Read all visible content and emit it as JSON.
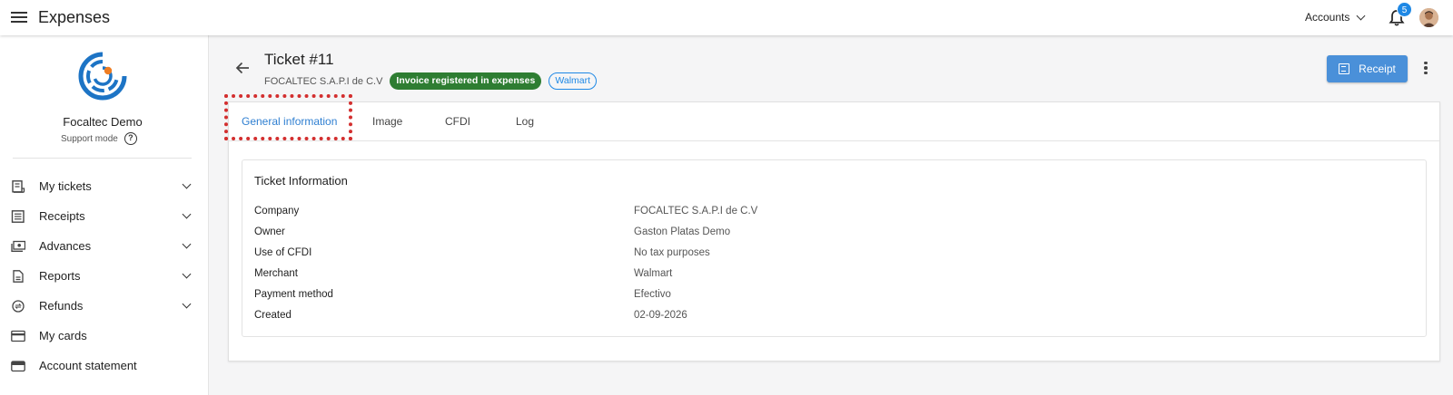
{
  "topbar": {
    "menu_icon": "menu-icon",
    "title": "Expenses",
    "accounts_label": "Accounts",
    "notification_count": "5"
  },
  "sidebar": {
    "org_name": "Focaltec Demo",
    "support_mode": "Support mode",
    "items": [
      {
        "label": "My tickets",
        "icon": "receipt-long-icon",
        "expandable": true
      },
      {
        "label": "Receipts",
        "icon": "list-alt-icon",
        "expandable": true
      },
      {
        "label": "Advances",
        "icon": "payments-icon",
        "expandable": true
      },
      {
        "label": "Reports",
        "icon": "file-report-icon",
        "expandable": true
      },
      {
        "label": "Refunds",
        "icon": "currency-exchange-icon",
        "expandable": true
      },
      {
        "label": "My cards",
        "icon": "credit-card-icon",
        "expandable": false
      },
      {
        "label": "Account statement",
        "icon": "wallet-icon",
        "expandable": false
      }
    ]
  },
  "ticket": {
    "title": "Ticket #11",
    "company": "FOCALTEC S.A.P.I de C.V",
    "status": "Invoice registered in expenses",
    "merchant_chip": "Walmart",
    "receipt_button": "Receipt"
  },
  "tabs": [
    {
      "label": "General information",
      "active": true
    },
    {
      "label": "Image",
      "active": false
    },
    {
      "label": "CFDI",
      "active": false
    },
    {
      "label": "Log",
      "active": false
    }
  ],
  "info": {
    "title": "Ticket Information",
    "rows": [
      {
        "key": "Company",
        "value": "FOCALTEC S.A.P.I de C.V"
      },
      {
        "key": "Owner",
        "value": "Gaston Platas Demo"
      },
      {
        "key": "Use of CFDI",
        "value": "No tax purposes"
      },
      {
        "key": "Merchant",
        "value": "Walmart"
      },
      {
        "key": "Payment method",
        "value": "Efectivo"
      },
      {
        "key": "Created",
        "value": "02-09-2026"
      }
    ]
  },
  "colors": {
    "accent": "#2f7fd1",
    "status_green": "#2e7d32",
    "primary_button": "#4a90d9",
    "badge_blue": "#1e88e5",
    "highlight_red": "#d32f2f"
  }
}
